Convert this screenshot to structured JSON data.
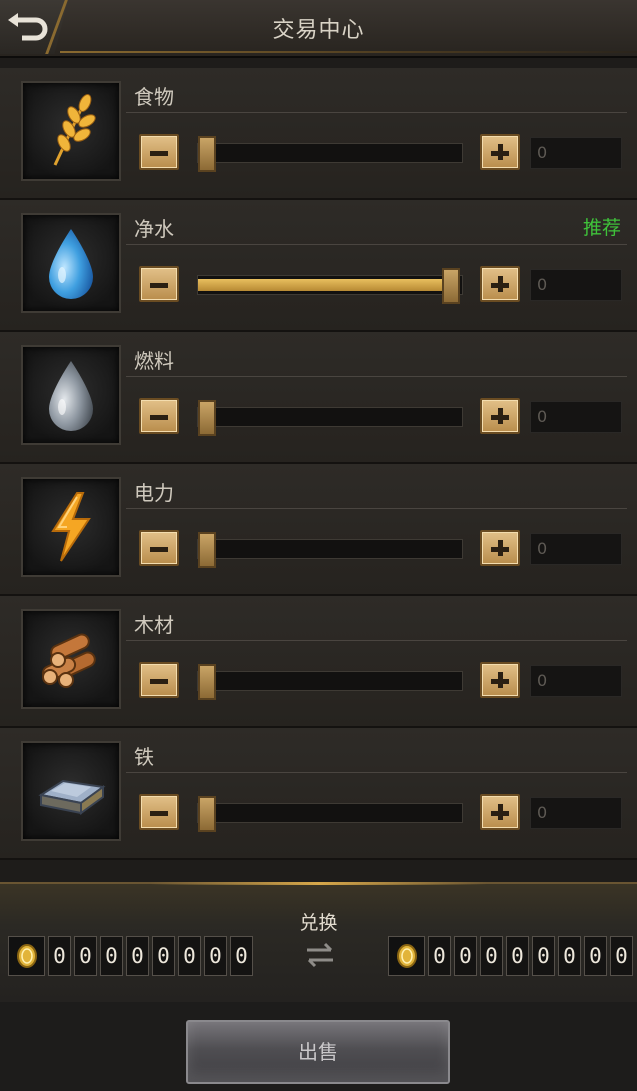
{
  "header": {
    "title": "交易中心",
    "back_icon": "back-arrow-icon"
  },
  "resources": [
    {
      "name": "食物",
      "icon": "wheat-icon",
      "level": 0.0,
      "quantity": "0",
      "recommended": ""
    },
    {
      "name": "净水",
      "icon": "water-drop-icon",
      "level": 1.0,
      "quantity": "0",
      "recommended": "推荐"
    },
    {
      "name": "燃料",
      "icon": "fuel-drop-icon",
      "level": 0.0,
      "quantity": "0",
      "recommended": ""
    },
    {
      "name": "电力",
      "icon": "lightning-icon",
      "level": 0.0,
      "quantity": "0",
      "recommended": ""
    },
    {
      "name": "木材",
      "icon": "logs-icon",
      "level": 0.0,
      "quantity": "0",
      "recommended": ""
    },
    {
      "name": "铁",
      "icon": "iron-ingot-icon",
      "level": 0.0,
      "quantity": "0",
      "recommended": ""
    }
  ],
  "exchange": {
    "label": "兑换",
    "left_digits": [
      "0",
      "0",
      "0",
      "0",
      "0",
      "0",
      "0",
      "0"
    ],
    "right_digits": [
      "0",
      "0",
      "0",
      "0",
      "0",
      "0",
      "0",
      "0"
    ],
    "coin_icon": "gold-coin-icon",
    "swap_icon": "swap-arrows-icon"
  },
  "sell_button": {
    "label": "出售"
  },
  "colors": {
    "accent_gold": "#e0b85c",
    "recommend_green": "#3fc23a",
    "background": "#1e1c1a"
  }
}
